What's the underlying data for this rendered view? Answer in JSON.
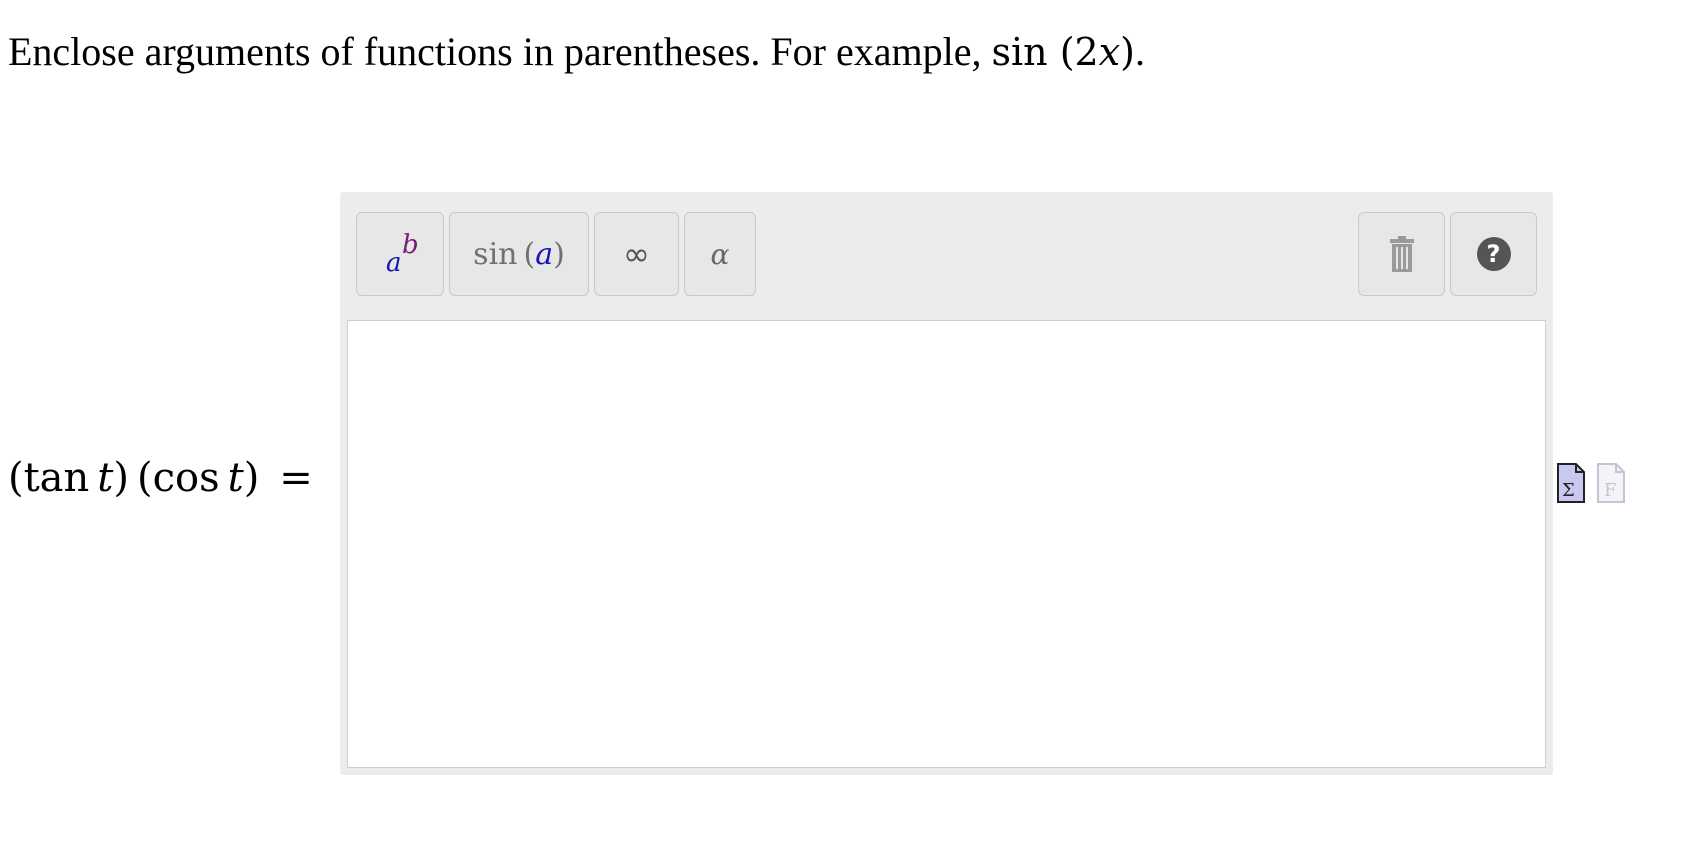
{
  "instruction": {
    "text": "Enclose arguments of functions in parentheses. For example,",
    "example_fn": "sin",
    "example_open": "(",
    "example_coef": "2",
    "example_var": "x",
    "example_close": ")",
    "example_end": "."
  },
  "question": {
    "lparen1": "(",
    "fn1": "tan",
    "var1": "t",
    "rparen1": ")",
    "lparen2": "(",
    "fn2": "cos",
    "var2": "t",
    "rparen2": ")",
    "equals": "="
  },
  "toolbar": {
    "power_base": "a",
    "power_exp": "b",
    "func_name": "sin",
    "func_open": "(",
    "func_arg": "a",
    "func_close": ")",
    "infinity": "∞",
    "greek": "α",
    "help": "?"
  },
  "answer": {
    "value": ""
  },
  "icons": {
    "trash": "trash-icon",
    "help": "help-icon",
    "math_doc": "math-document-icon",
    "text_doc": "text-document-icon"
  }
}
